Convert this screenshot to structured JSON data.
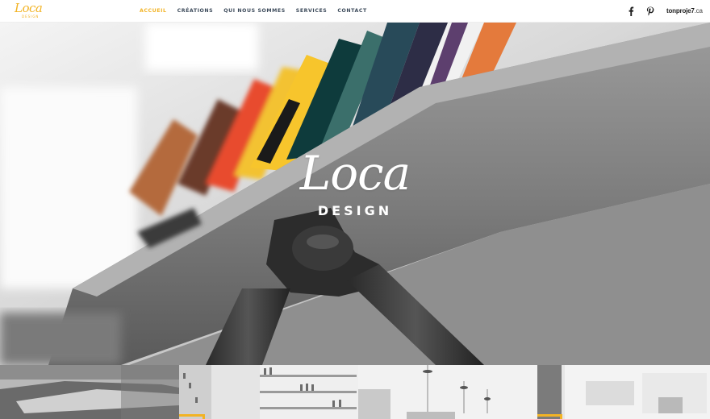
{
  "brand": {
    "logo_script": "Loca",
    "logo_sub": "DESIGN",
    "accent_color": "#f2b324"
  },
  "nav": {
    "items": [
      {
        "label": "ACCUEIL",
        "active": true
      },
      {
        "label": "CRÉATIONS",
        "active": false
      },
      {
        "label": "QUI NOUS SOMMES",
        "active": false
      },
      {
        "label": "SERVICES",
        "active": false
      },
      {
        "label": "CONTACT",
        "active": false
      }
    ]
  },
  "social": {
    "facebook_icon": "facebook-icon",
    "pinterest_icon": "pinterest-icon"
  },
  "partner": {
    "name": "tonproje7",
    "suffix": ".ca"
  },
  "hero": {
    "logo_script": "Loca",
    "logo_sub": "DESIGN"
  },
  "strip": {
    "tiles": [
      "tile-1",
      "tile-2",
      "tile-3",
      "tile-4"
    ]
  }
}
